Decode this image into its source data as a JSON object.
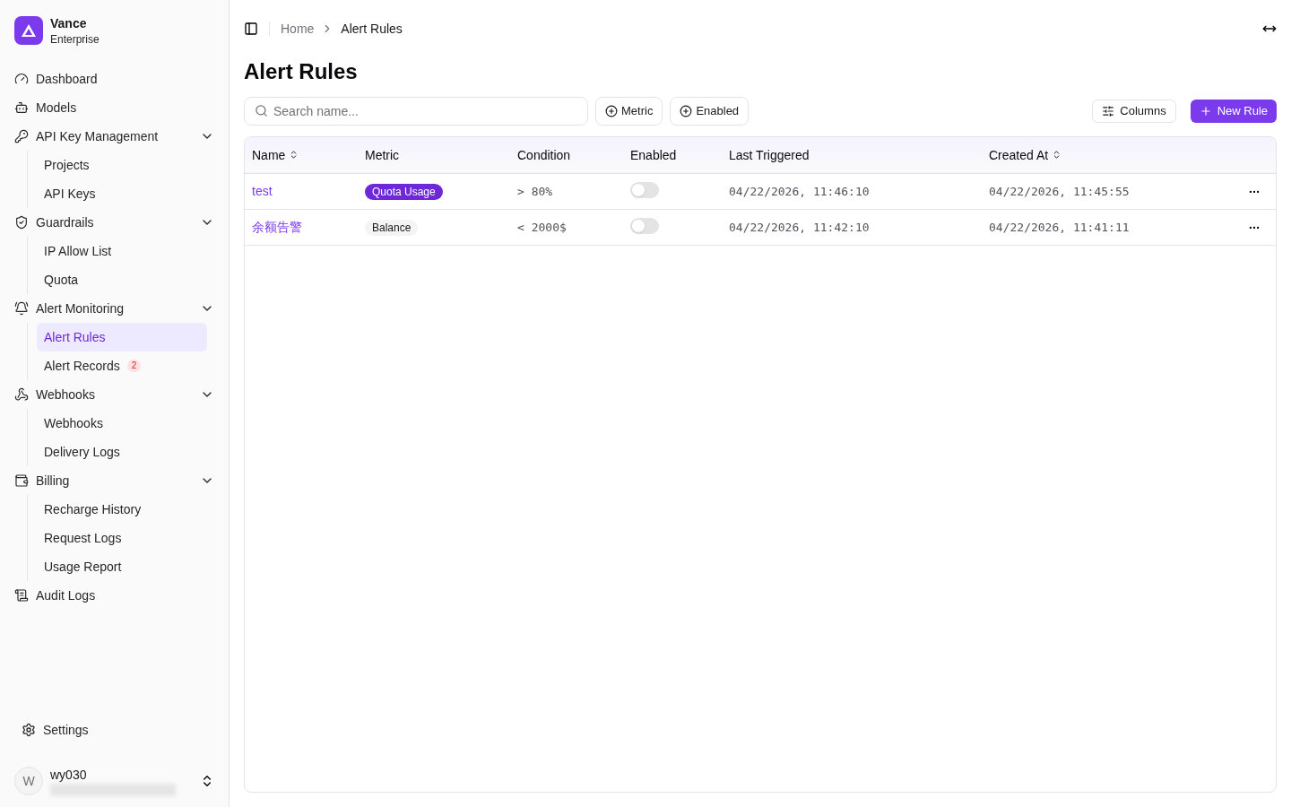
{
  "brand": {
    "name": "Vance",
    "plan": "Enterprise"
  },
  "nav": [
    {
      "label": "Dashboard"
    },
    {
      "label": "Models"
    },
    {
      "label": "API Key Management",
      "expanded": true,
      "children": [
        {
          "label": "Projects",
          "selected": false
        },
        {
          "label": "API Keys",
          "selected": false
        }
      ]
    },
    {
      "label": "Guardrails",
      "expanded": true,
      "children": [
        {
          "label": "IP Allow List",
          "selected": false
        },
        {
          "label": "Quota",
          "selected": false
        }
      ]
    },
    {
      "label": "Alert Monitoring",
      "expanded": true,
      "children": [
        {
          "label": "Alert Rules",
          "selected": true
        },
        {
          "label": "Alert Records",
          "selected": false,
          "badge": "2"
        }
      ]
    },
    {
      "label": "Webhooks",
      "expanded": true,
      "children": [
        {
          "label": "Webhooks",
          "selected": false
        },
        {
          "label": "Delivery Logs",
          "selected": false
        }
      ]
    },
    {
      "label": "Billing",
      "expanded": true,
      "children": [
        {
          "label": "Recharge History",
          "selected": false
        },
        {
          "label": "Request Logs",
          "selected": false
        },
        {
          "label": "Usage Report",
          "selected": false
        }
      ]
    },
    {
      "label": "Audit Logs"
    }
  ],
  "settings": "Settings",
  "user": {
    "initial": "W",
    "name": "wy030"
  },
  "breadcrumb": [
    "Home",
    "Alert Rules"
  ],
  "page_title": "Alert Rules",
  "search": {
    "placeholder": "Search name..."
  },
  "filters": [
    "Metric",
    "Enabled"
  ],
  "columns_button": "Columns",
  "new_button": "New Rule",
  "table": {
    "columns": [
      {
        "label": "Name",
        "sortable": true
      },
      {
        "label": "Metric",
        "sortable": false
      },
      {
        "label": "Condition",
        "sortable": false
      },
      {
        "label": "Enabled",
        "sortable": false
      },
      {
        "label": "Last Triggered",
        "sortable": false
      },
      {
        "label": "Created At",
        "sortable": true
      }
    ],
    "rows": [
      {
        "name": "test",
        "metric": "Quota Usage",
        "kind": "primary",
        "condition": "> 80%",
        "enabled": false,
        "last_triggered": "04/22/2026, 11:46:10",
        "created_at": "04/22/2026, 11:45:55"
      },
      {
        "name": "余额告警",
        "metric": "Balance",
        "kind": "secondary",
        "condition": "< 2000$",
        "enabled": false,
        "last_triggered": "04/22/2026, 11:42:10",
        "created_at": "04/22/2026, 11:41:11"
      }
    ]
  }
}
